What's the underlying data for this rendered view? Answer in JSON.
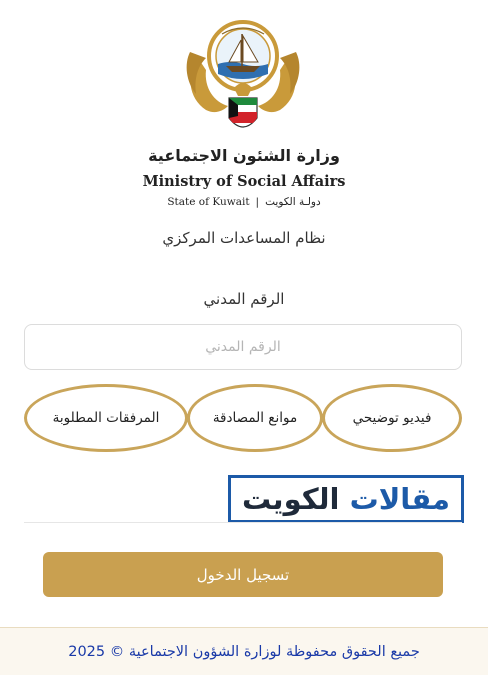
{
  "header": {
    "emblem_icon": "kuwait-state-emblem",
    "ministry_name_ar": "وزارة الشئون الاجتماعية",
    "ministry_name_en": "Ministry of Social Affairs",
    "state_en": "State of Kuwait",
    "state_separator": "|",
    "state_ar": "دولـة الكويت"
  },
  "system_title": "نظام المساعدات المركزي",
  "form": {
    "civil_id_label": "الرقم المدني",
    "civil_id_placeholder": "الرقم المدني",
    "civil_id_value": ""
  },
  "links": {
    "video": "فيديو توضيحي",
    "auth_obstacles": "موانع المصادقة",
    "attachments": "المرفقات المطلوبة"
  },
  "watermark": {
    "word1": "مقالات",
    "word2": "الكويت"
  },
  "login_button": "تسجيل الدخول",
  "footer": "جميع الحقوق محفوظة لوزارة الشؤون الاجتماعية © 2025",
  "colors": {
    "gold": "#c9a050",
    "pill_border": "#c9a55a",
    "footer_text": "#1a3aa8",
    "watermark_blue": "#1c5aa8"
  }
}
